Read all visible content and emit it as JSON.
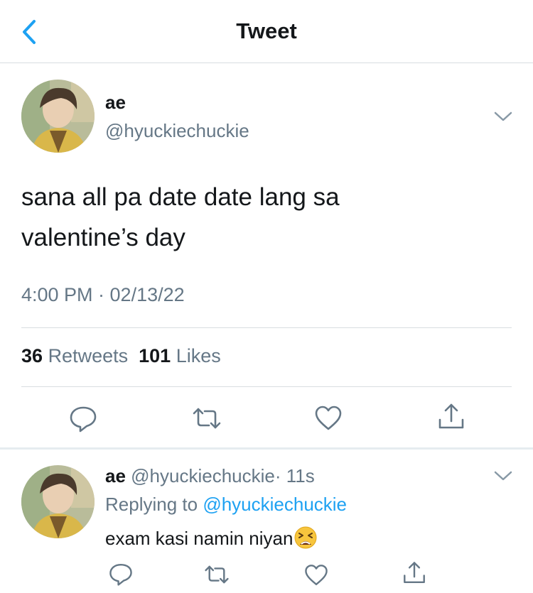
{
  "header": {
    "title": "Tweet"
  },
  "tweet": {
    "name": "ae",
    "handle": "@hyuckiechuckie",
    "text_line1": "sana all pa date date lang sa",
    "text_line2": "valentine’s day",
    "timestamp": "4:00 PM · 02/13/22",
    "retweets_count": "36",
    "retweets_label": "Retweets",
    "likes_count": "101",
    "likes_label": "Likes"
  },
  "reply": {
    "name": "ae",
    "handle": "@hyuckiechuckie",
    "time": "· 11s",
    "replying_prefix": "Replying to",
    "replying_to": "@hyuckiechuckie",
    "text": "exam kasi namin niyan",
    "emoji": "tired-face-emoji"
  },
  "icons": [
    "back-chevron-icon",
    "chevron-down-icon",
    "reply-icon",
    "retweet-icon",
    "like-icon",
    "share-icon"
  ],
  "colors": {
    "accent": "#1da1f2",
    "text": "#14171a",
    "secondary": "#657786",
    "divider": "#d8dde1"
  }
}
